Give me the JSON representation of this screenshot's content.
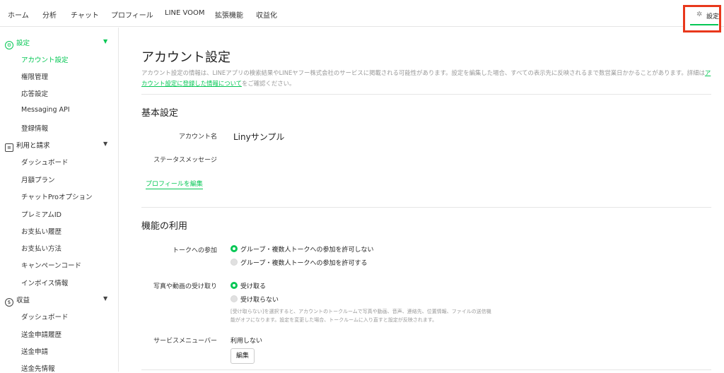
{
  "topnav": {
    "items": [
      "ホーム",
      "分析",
      "チャット",
      "プロフィール",
      "LINE VOOM",
      "拡張機能",
      "収益化"
    ],
    "settings_label": "設定"
  },
  "sidebar": {
    "settings_head": "設定",
    "settings_items": [
      "アカウント設定",
      "権限管理",
      "応答設定",
      "Messaging API",
      "登録情報"
    ],
    "billing_head": "利用と請求",
    "billing_items": [
      "ダッシュボード",
      "月額プラン",
      "チャットProオプション",
      "プレミアムID",
      "お支払い履歴",
      "お支払い方法",
      "キャンペーンコード",
      "インボイス情報"
    ],
    "revenue_head": "収益",
    "revenue_items": [
      "ダッシュボード",
      "送金申請履歴",
      "送金申請",
      "送金先情報"
    ]
  },
  "main": {
    "title": "アカウント設定",
    "desc_before": "アカウント設定の情報は、LINEアプリの検索結果やLINEヤフー株式会社のサービスに掲載される可能性があります。設定を編集した場合、すべての表示先に反映されるまで数営業日かかることがあります。詳細は",
    "desc_link": "アカウント設定に登録した情報について",
    "desc_after": "をご確認ください。",
    "basic": {
      "title": "基本設定",
      "account_name_label": "アカウント名",
      "account_name_value": "Linyサンプル",
      "status_label": "ステータスメッセージ",
      "edit_profile": "プロフィールを編集"
    },
    "features": {
      "title": "機能の利用",
      "talk_label": "トークへの参加",
      "talk_opt1": "グループ・複数人トークへの参加を許可しない",
      "talk_opt2": "グループ・複数人トークへの参加を許可する",
      "media_label": "写真や動画の受け取り",
      "media_opt1": "受け取る",
      "media_opt2": "受け取らない",
      "media_note": "[受け取らない]を選択すると、アカウントのトークルームで写真や動画、音声、連絡先、位置情報、ファイルの送信機能がオフになります。設定を変更した場合、トークルームに入り直すと設定が反映されます。",
      "service_menu_label": "サービスメニューバー",
      "service_menu_value": "利用しない",
      "edit_button": "編集"
    }
  }
}
